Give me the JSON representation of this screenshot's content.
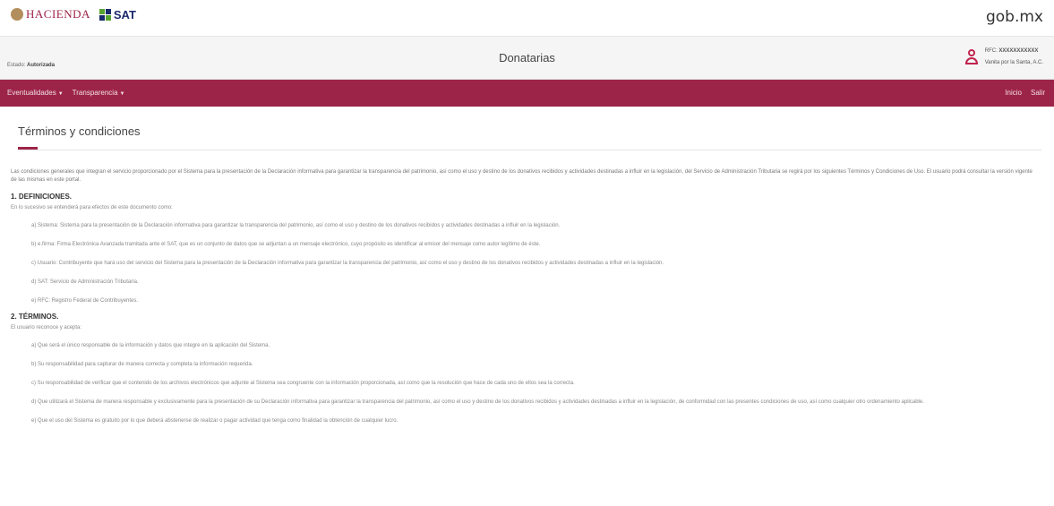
{
  "branding": {
    "hacienda": "HACIENDA",
    "sat": "SAT",
    "gobmx": "gob.mx"
  },
  "header": {
    "estado_label": "Estado:",
    "estado_value": "Autorizada",
    "title": "Donatarias",
    "rfc_label": "RFC:",
    "rfc_value": "XXXXXXXXXXX",
    "org_name": "Vanita por la Santa, A.C."
  },
  "nav": {
    "left": [
      "Eventualidades",
      "Transparencia"
    ],
    "right": [
      "Inicio",
      "Salir"
    ]
  },
  "page": {
    "title": "Términos y condiciones",
    "intro": "Las condiciones generales que integran el servicio proporcionado por el Sistema para la presentación de la Declaración informativa para garantizar la transparencia del patrimonio, así como el uso y destino de los donativos recibidos y actividades destinadas a influir en la legislación, del Servicio de Administración Tributaria se regirá por los siguientes Términos y Condiciones de Uso. El usuario podrá consultar la versión vigente de las mismas en este portal.",
    "sections": [
      {
        "title": "1. DEFINICIONES.",
        "lead": "En lo sucesivo se entenderá para efectos de este documento como:",
        "items": [
          "a) Sistema: Sistema para la presentación de la Declaración informativa para garantizar la transparencia del patrimonio, así como el uso y destino de los donativos recibidos y actividades destinadas a influir en la legislación.",
          "b) e.firma: Firma Electrónica Avanzada tramitada ante el SAT, que es un conjunto de datos que se adjuntan a un mensaje electrónico, cuyo propósito es identificar al emisor del mensaje como autor legítimo de éste.",
          "c) Usuario: Contribuyente que hará uso del servicio del Sistema para la presentación de la Declaración informativa para garantizar la transparencia del patrimonio, así como el uso y destino de los donativos recibidos y actividades destinadas a influir en la legislación.",
          "d) SAT: Servicio de Administración Tributaria.",
          "e) RFC: Registro Federal de Contribuyentes."
        ]
      },
      {
        "title": "2. TÉRMINOS.",
        "lead": "El usuario reconoce y acepta:",
        "items": [
          "a) Que será el único responsable de la información y datos que integre en la aplicación del Sistema.",
          "b) Su responsabilidad para capturar de manera correcta y completa la información requerida.",
          "c) Su responsabilidad de verificar que el contenido de los archivos electrónicos que adjunte al Sistema sea congruente con la información proporcionada, así como que la resolución que hace de cada uno de ellos sea la correcta.",
          "d) Que utilizará el Sistema de manera responsable y exclusivamente para la presentación de su Declaración informativa para garantizar la transparencia del patrimonio, así como el uso y destino de los donativos recibidos y actividades destinadas a influir en la legislación, de conformidad con las presentes condiciones de uso, así como cualquier otro ordenamiento aplicable.",
          "e) Que el uso del Sistema es gratuito por lo que deberá abstenerse de realizar o pagar actividad que tenga como finalidad la obtención de cualquier lucro."
        ]
      }
    ]
  },
  "colors": {
    "brand": "#9d2449",
    "gold": "#b38e5d",
    "sat_blue": "#1a2a6c",
    "sat_green": "#5aa532"
  }
}
